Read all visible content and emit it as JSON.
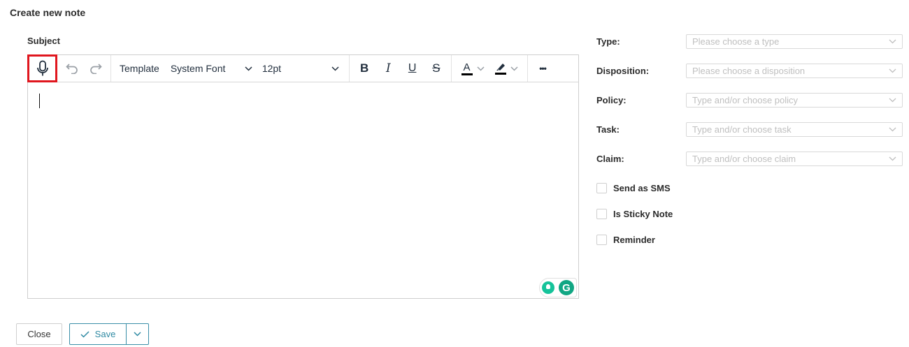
{
  "page": {
    "title": "Create new note"
  },
  "subject": {
    "label": "Subject"
  },
  "toolbar": {
    "mic_icon": "microphone-icon",
    "undo_icon": "undo-icon",
    "redo_icon": "redo-icon",
    "template_label": "Template",
    "font_family": "System Font",
    "font_size": "12pt",
    "bold_label": "B",
    "italic_label": "I",
    "underline_label": "U",
    "strike_label": "S",
    "text_color_label": "A",
    "more_label": "•••",
    "highlight_color": "#000000",
    "text_color": "#000000"
  },
  "grammarly": {
    "logo_letter": "G"
  },
  "form": {
    "type": {
      "label": "Type:",
      "placeholder": "Please choose a type"
    },
    "disposition": {
      "label": "Disposition:",
      "placeholder": "Please choose a disposition"
    },
    "policy": {
      "label": "Policy:",
      "placeholder": "Type and/or choose policy"
    },
    "task": {
      "label": "Task:",
      "placeholder": "Type and/or choose task"
    },
    "claim": {
      "label": "Claim:",
      "placeholder": "Type and/or choose claim"
    }
  },
  "checkboxes": {
    "send_sms": "Send as SMS",
    "sticky": "Is Sticky Note",
    "reminder": "Reminder"
  },
  "footer": {
    "close_label": "Close",
    "save_label": "Save"
  },
  "colors": {
    "accent": "#2f8aa3",
    "highlight_box": "#e0161e",
    "grammarly": "#15c39a"
  }
}
